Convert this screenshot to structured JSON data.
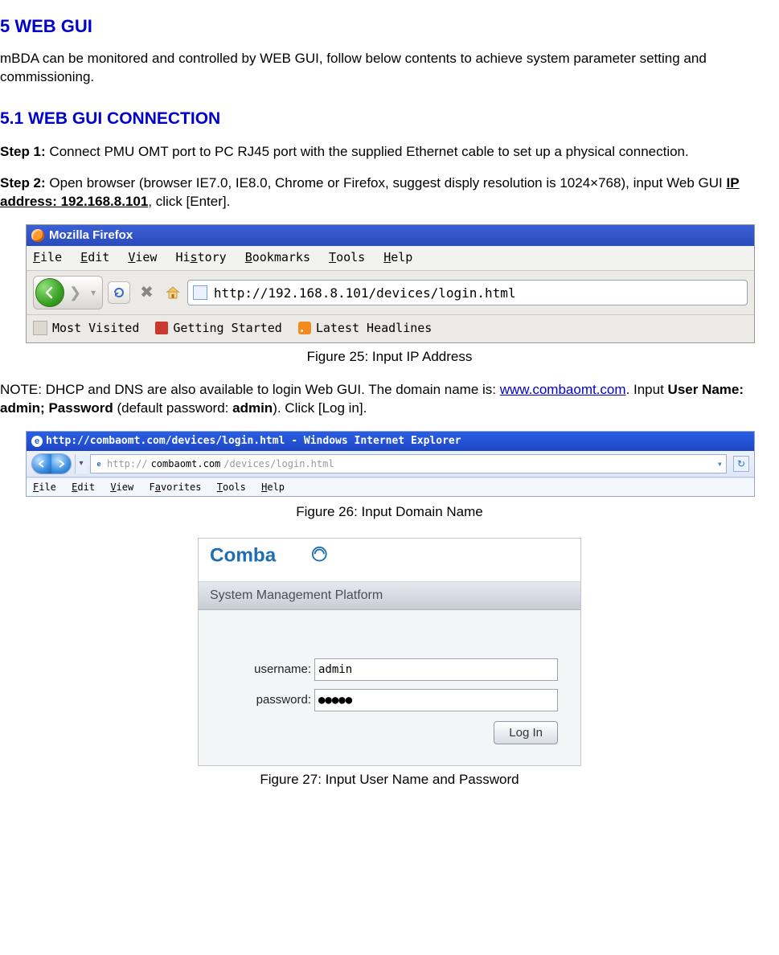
{
  "sections": {
    "h1": "5   WEB GUI",
    "intro": "mBDA can be monitored and controlled by WEB GUI, follow below contents to achieve system parameter setting and commissioning.",
    "h2": "5.1     WEB GUI CONNECTION",
    "step1_b": "Step 1:",
    "step1": " Connect PMU OMT port to PC RJ45 port with the supplied Ethernet cable to set up a physical connection.",
    "step2_b": "Step 2:",
    "step2_a": " Open browser (browser IE7.0, IE8.0, Chrome or Firefox, suggest disply resolution is 1024×768), input Web GUI ",
    "step2_ip_b": "IP address: 192.168.8.101",
    "step2_c": ", click [Enter].",
    "fig25": "Figure 25: Input IP Address",
    "note_a": "NOTE: DHCP and DNS are also available to login Web GUI. The domain name is: ",
    "note_link": "www.combaomt.com",
    "note_b": ". Input ",
    "note_c_b": "User Name: admin; Password",
    "note_d": " (default password: ",
    "note_e_b": "admin",
    "note_f": "). Click [Log in].",
    "fig26": "Figure 26: Input Domain Name",
    "fig27": "Figure 27: Input User Name and Password"
  },
  "firefox": {
    "title": "Mozilla Firefox",
    "menu": {
      "file": "File",
      "edit": "Edit",
      "view": "View",
      "history": "History",
      "bookmarks": "Bookmarks",
      "tools": "Tools",
      "help": "Help"
    },
    "url": "http://192.168.8.101/devices/login.html",
    "bookbar": {
      "most": "Most Visited",
      "getting": "Getting Started",
      "latest": "Latest Headlines"
    }
  },
  "ie": {
    "title": "http://combaomt.com/devices/login.html - Windows Internet Explorer",
    "url_prefix": "http://",
    "url_domain": "combaomt.com",
    "url_suffix": "/devices/login.html",
    "menu": {
      "file": "File",
      "edit": "Edit",
      "view": "View",
      "fav": "Favorites",
      "tools": "Tools",
      "help": "Help"
    }
  },
  "login": {
    "header": "System Management Platform",
    "user_label": "username:",
    "user_value": "admin",
    "pass_label": "password:",
    "pass_value": "●●●●●",
    "button": "Log In"
  }
}
